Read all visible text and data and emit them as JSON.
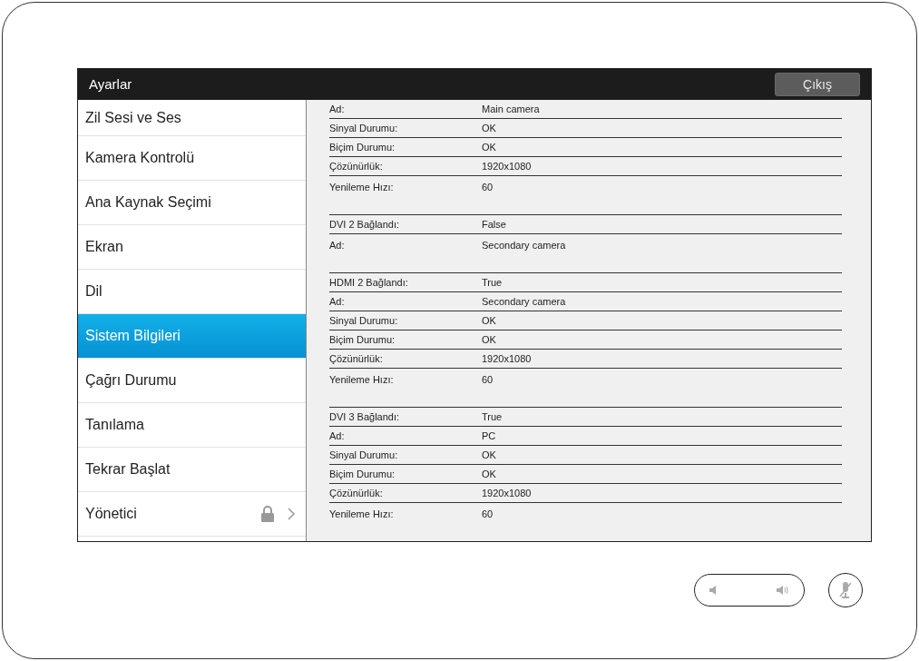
{
  "header": {
    "title": "Ayarlar",
    "exit_button": "Çıkış"
  },
  "sidebar": {
    "items": [
      {
        "label": "Zil Sesi ve Ses",
        "selected": false,
        "locked": false
      },
      {
        "label": "Kamera Kontrolü",
        "selected": false,
        "locked": false
      },
      {
        "label": "Ana Kaynak Seçimi",
        "selected": false,
        "locked": false
      },
      {
        "label": "Ekran",
        "selected": false,
        "locked": false
      },
      {
        "label": "Dil",
        "selected": false,
        "locked": false
      },
      {
        "label": "Sistem Bilgileri",
        "selected": true,
        "locked": false
      },
      {
        "label": "Çağrı Durumu",
        "selected": false,
        "locked": false
      },
      {
        "label": "Tanılama",
        "selected": false,
        "locked": false
      },
      {
        "label": "Tekrar Başlat",
        "selected": false,
        "locked": false
      },
      {
        "label": "Yönetici",
        "selected": false,
        "locked": true
      }
    ]
  },
  "info_groups": [
    [
      {
        "label": "Ad:",
        "value": "Main camera"
      },
      {
        "label": "Sinyal Durumu:",
        "value": "OK"
      },
      {
        "label": "Biçim Durumu:",
        "value": "OK"
      },
      {
        "label": "Çözünürlük:",
        "value": "1920x1080"
      },
      {
        "label": "Yenileme Hızı:",
        "value": "60"
      }
    ],
    [
      {
        "label": "DVI 2 Bağlandı:",
        "value": "False"
      },
      {
        "label": "Ad:",
        "value": "Secondary camera"
      }
    ],
    [
      {
        "label": "HDMI 2 Bağlandı:",
        "value": "True"
      },
      {
        "label": "Ad:",
        "value": "Secondary camera"
      },
      {
        "label": "Sinyal Durumu:",
        "value": "OK"
      },
      {
        "label": "Biçim Durumu:",
        "value": "OK"
      },
      {
        "label": "Çözünürlük:",
        "value": "1920x1080"
      },
      {
        "label": "Yenileme Hızı:",
        "value": "60"
      }
    ],
    [
      {
        "label": "DVI 3 Bağlandı:",
        "value": "True"
      },
      {
        "label": "Ad:",
        "value": "PC"
      },
      {
        "label": "Sinyal Durumu:",
        "value": "OK"
      },
      {
        "label": "Biçim Durumu:",
        "value": "OK"
      },
      {
        "label": "Çözünürlük:",
        "value": "1920x1080"
      },
      {
        "label": "Yenileme Hızı:",
        "value": "60"
      }
    ]
  ]
}
